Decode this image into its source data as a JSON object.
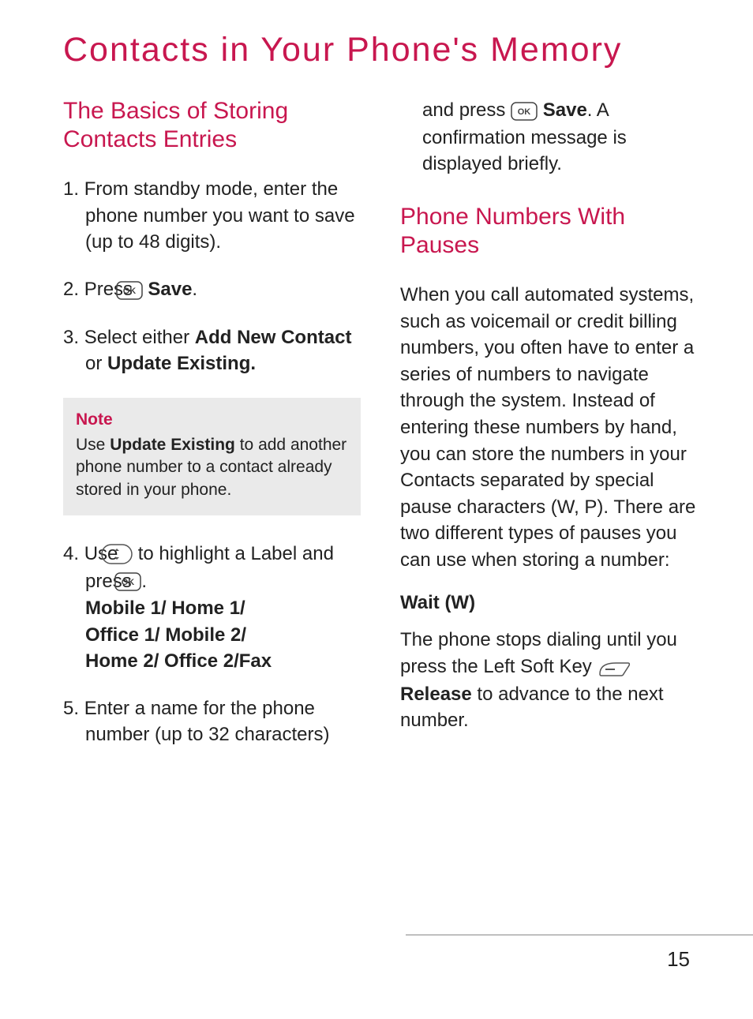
{
  "title": "Contacts in Your Phone's Memory",
  "page_number": "15",
  "left": {
    "heading": "The Basics of Storing Contacts Entries",
    "step1_num": "1.",
    "step1": "From standby mode, enter the phone number you want to save (up to 48 digits).",
    "step2_num": "2.",
    "step2_a": "Press ",
    "step2_b": " Save",
    "step2_c": ".",
    "step3_num": "3.",
    "step3_a": "Select either ",
    "step3_b": "Add New Contact",
    "step3_c": " or ",
    "step3_d": "Update Existing.",
    "note_title": "Note",
    "note_a": "Use ",
    "note_b": "Update Existing",
    "note_c": " to add another phone number to a contact already stored in your phone.",
    "step4_num": "4.",
    "step4_a": "Use ",
    "step4_b": " to highlight a Label and press ",
    "step4_c": ".",
    "step4_labels_1": "Mobile 1/ Home 1/",
    "step4_labels_2": "Office 1/ Mobile 2/",
    "step4_labels_3": "Home 2/ Office 2/Fax",
    "step5_num": "5.",
    "step5": "Enter a name for the phone number (up to 32 characters)"
  },
  "right": {
    "cont_a": "and press ",
    "cont_b": " Save",
    "cont_c": ". A confirmation message is displayed briefly.",
    "heading": "Phone Numbers With Pauses",
    "para": "When you call automated systems, such as voicemail or credit billing numbers, you often have to enter a series of numbers to navigate through the system. Instead of entering these numbers by hand, you can store the numbers in your Contacts separated by special pause characters (W, P). There are two different types of pauses you can use when storing a number:",
    "wait_heading": "Wait (W)",
    "wait_a": "The phone stops dialing until you press the Left Soft Key ",
    "wait_b": " Release",
    "wait_c": " to advance to the next number."
  }
}
